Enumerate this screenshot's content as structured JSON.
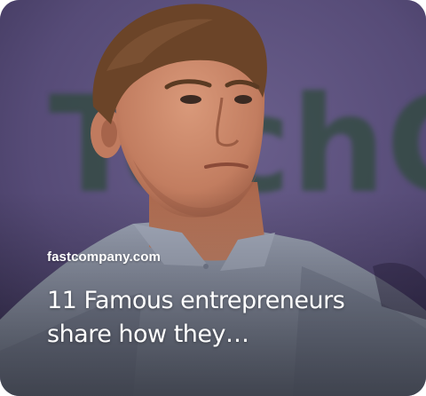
{
  "card": {
    "source": "fastcompany.com",
    "title_lines": [
      "11 Famous entrepreneurs",
      "share how they…"
    ],
    "background_text": "TechCr",
    "colors": {
      "backdrop": "#5a4f7a",
      "backdrop_text": "#2f4a3c",
      "shirt": "#8f96a8",
      "skin": "#c8896c",
      "hair": "#6b4428",
      "text": "#ffffff"
    }
  }
}
